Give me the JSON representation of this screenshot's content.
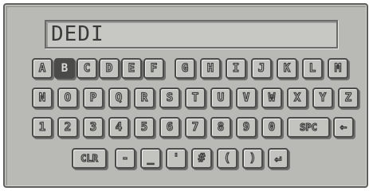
{
  "input": {
    "value": "DEDI"
  },
  "keys": {
    "A": "A",
    "B": "B",
    "C": "C",
    "D": "D",
    "E": "E",
    "F": "F",
    "G": "G",
    "H": "H",
    "I": "I",
    "J": "J",
    "K": "K",
    "L": "L",
    "M": "M",
    "N": "N",
    "O": "O",
    "P": "P",
    "Q": "Q",
    "R": "R",
    "S": "S",
    "T": "T",
    "U": "U",
    "V": "V",
    "W": "W",
    "X": "X",
    "Y": "Y",
    "Z": "Z",
    "n1": "1",
    "n2": "2",
    "n3": "3",
    "n4": "4",
    "n5": "5",
    "n6": "6",
    "n7": "7",
    "n8": "8",
    "n9": "9",
    "n0": "0",
    "spc": "SPC",
    "backspace": "←",
    "clr": "CLR",
    "minus": "-",
    "underscore": "_",
    "apostrophe": "'",
    "hash": "#",
    "lparen": "(",
    "rparen": ")",
    "enter": "↵"
  },
  "selected_key": "B",
  "icons": {
    "backspace": "backspace-arrow-icon",
    "enter": "enter-return-icon"
  }
}
